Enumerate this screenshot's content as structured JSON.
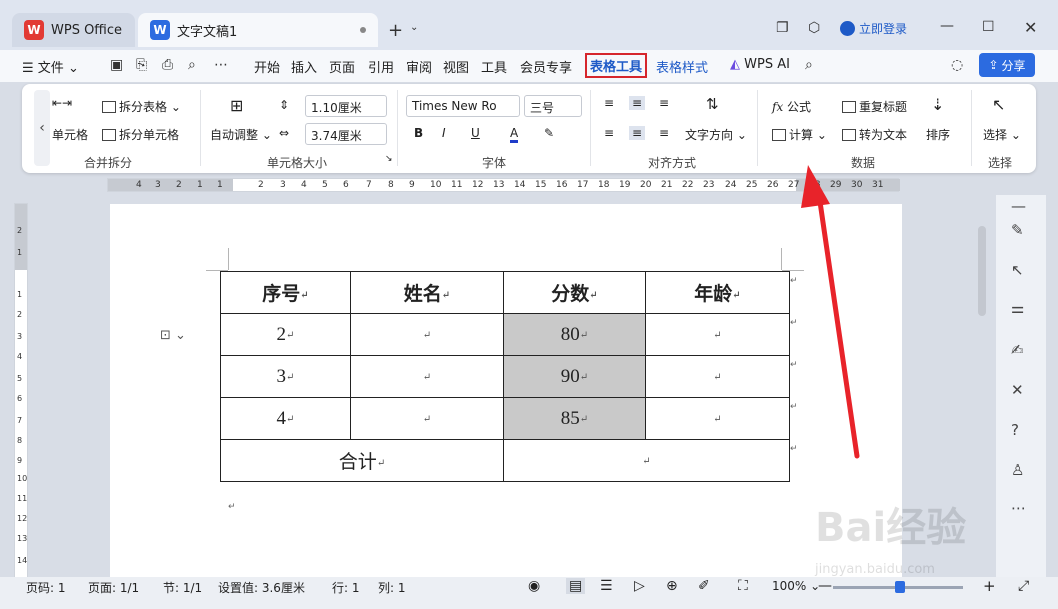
{
  "tabs": {
    "home": "WPS Office",
    "doc": "文字文稿1"
  },
  "account": {
    "login": "立即登录"
  },
  "menu": {
    "file": "文件",
    "items": [
      "开始",
      "插入",
      "页面",
      "引用",
      "审阅",
      "视图",
      "工具",
      "会员专享"
    ],
    "table_tool": "表格工具",
    "table_style": "表格样式",
    "wps_ai": "WPS AI",
    "share": "分享"
  },
  "ribbon": {
    "merge_cells": "单元格",
    "split_table": "拆分表格",
    "split_cells": "拆分单元格",
    "merge_group": "合并拆分",
    "auto_adjust": "自动调整",
    "row_height": "1.10厘米",
    "col_width": "3.74厘米",
    "cell_size_group": "单元格大小",
    "font_name": "Times New Ro",
    "font_size": "三号",
    "bold": "B",
    "italic": "I",
    "underline": "U",
    "font_color": "A",
    "font_group": "字体",
    "text_dir": "文字方向",
    "align_group": "对齐方式",
    "formula": "公式",
    "calculate": "计算",
    "repeat_header": "重复标题",
    "to_text": "转为文本",
    "sort": "排序",
    "data_group": "数据",
    "select": "选择",
    "select_group": "选择"
  },
  "ruler": {
    "h_ticks": [
      "4",
      "3",
      "2",
      "1",
      "1",
      "2",
      "3",
      "4",
      "5",
      "6",
      "7",
      "8",
      "9",
      "10",
      "11",
      "12",
      "13",
      "14",
      "15",
      "16",
      "17",
      "18",
      "19",
      "20",
      "21",
      "22",
      "23",
      "24",
      "25",
      "26",
      "27",
      "28",
      "29",
      "30",
      "31"
    ],
    "v_ticks": [
      "2",
      "1",
      "1",
      "2",
      "3",
      "4",
      "5",
      "6",
      "7",
      "8",
      "9",
      "10",
      "11",
      "12",
      "13",
      "14"
    ]
  },
  "table": {
    "headers": [
      "序号",
      "姓名",
      "分数",
      "年龄"
    ],
    "rows": [
      [
        "2",
        "",
        "80",
        ""
      ],
      [
        "3",
        "",
        "90",
        ""
      ],
      [
        "4",
        "",
        "85",
        ""
      ]
    ],
    "total_label": "合计",
    "paragraph_mark": "↵"
  },
  "status": {
    "page_no": "页码: 1",
    "pages": "页面: 1/1",
    "section": "节: 1/1",
    "setting": "设置值: 3.6厘米",
    "row": "行: 1",
    "col": "列: 1",
    "zoom": "100%"
  },
  "watermark": {
    "main": "Bai经验",
    "sub": "jingyan.baidu.com"
  },
  "colors": {
    "accent": "#2c6be0",
    "highlight_box": "#d6262c",
    "arrow": "#e8232a",
    "cell_shade": "#c9c9c9"
  }
}
